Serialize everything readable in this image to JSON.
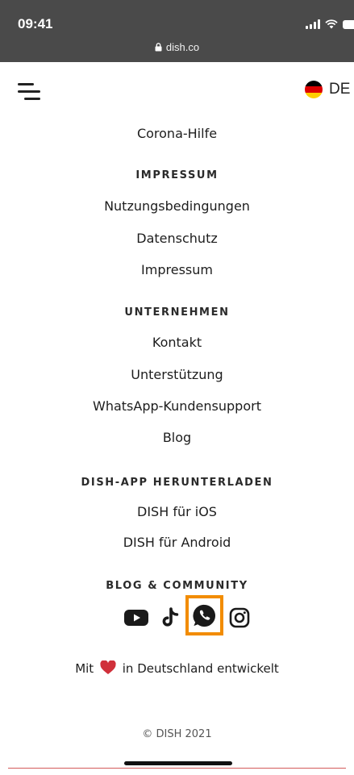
{
  "status_bar": {
    "time": "09:41",
    "url": "dish.co"
  },
  "header": {
    "menu_icon": "menu-icon",
    "language": "DE",
    "flag_colors": [
      "#000000",
      "#dd0000",
      "#ffce00"
    ]
  },
  "footer": {
    "top_link": "Corona-Hilfe",
    "sections": [
      {
        "heading": "IMPRESSUM",
        "links": [
          "Nutzungsbedingungen",
          "Datenschutz",
          "Impressum"
        ]
      },
      {
        "heading": "UNTERNEHMEN",
        "links": [
          "Kontakt",
          "Unterstützung",
          "WhatsApp-Kundensupport",
          "Blog"
        ]
      },
      {
        "heading": "DISH-APP HERUNTERLADEN",
        "links": [
          "DISH für iOS",
          "DISH für Android"
        ]
      },
      {
        "heading": "BLOG & COMMUNITY",
        "links": []
      }
    ],
    "social_icons": [
      "youtube-icon",
      "tiktok-icon",
      "whatsapp-icon",
      "instagram-icon"
    ],
    "highlight_color": "#f28c00",
    "made_with_prefix": "Mit",
    "made_with_suffix": "in Deutschland entwickelt",
    "heart_color": "#d0303a",
    "copyright": "© DISH 2021"
  }
}
